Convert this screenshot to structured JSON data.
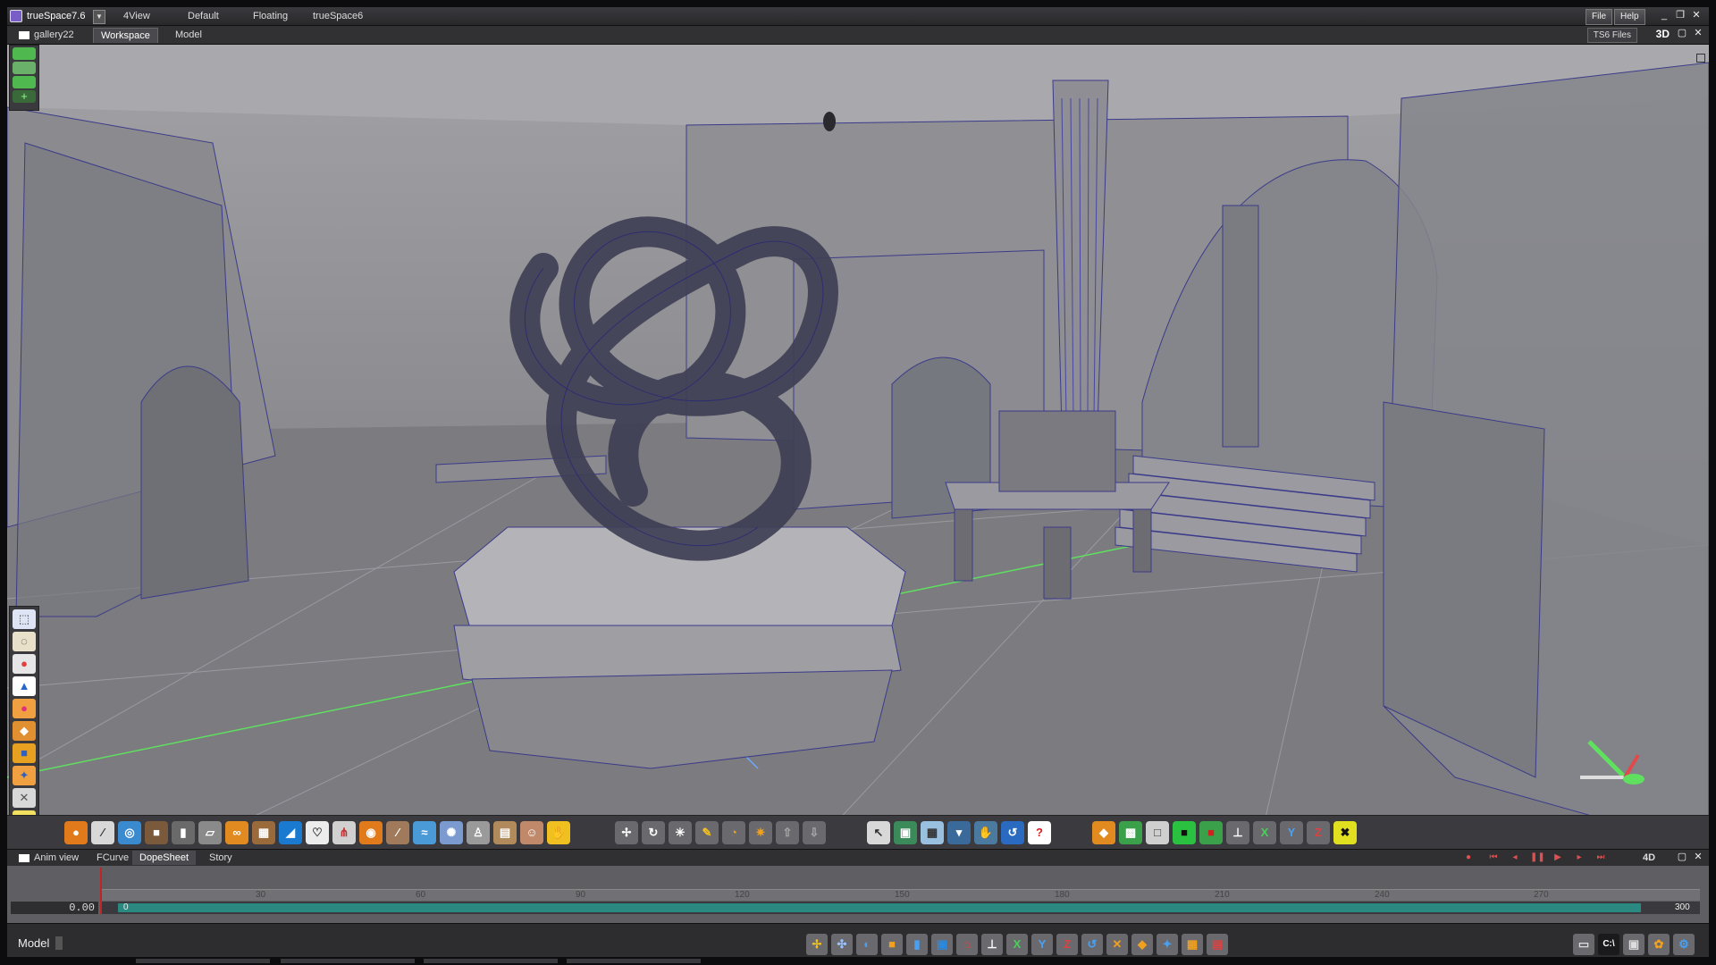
{
  "app": {
    "title": "trueSpace7.6",
    "layouts": [
      "4View",
      "Default",
      "Floating",
      "trueSpace6"
    ],
    "menu": {
      "file": "File",
      "help": "Help"
    },
    "window_controls": {
      "minimize": "_",
      "restore": "❐",
      "close": "✕"
    }
  },
  "tabs": {
    "scene": "gallery22",
    "workspace": "Workspace",
    "model": "Model",
    "files_button": "TS6 Files",
    "view_mode": "3D"
  },
  "viewport": {
    "colors": {
      "background_top": "#a2a2a6",
      "floor": "#7b7b80",
      "wireframe": "#3b3b8a",
      "axis_x": "#5fe05f",
      "axis_y": "#6aa8ff"
    }
  },
  "left_toolbar_icons": [
    "select-icon",
    "lasso-icon",
    "paint-icon",
    "cone-icon",
    "sphere-icon",
    "material-icon",
    "cube-icon",
    "light-icon",
    "wrench-icon",
    "pencil-icon",
    "gear-icon"
  ],
  "bottom_toolbar_icons": [
    "sphere-icon",
    "brush-icon",
    "torus-icon",
    "cube-icon",
    "cylinder-icon",
    "plane-icon",
    "knot-icon",
    "tree-icon",
    "stone-icon",
    "heart-icon",
    "fork-icon",
    "globe-icon",
    "wand-icon",
    "text-icon",
    "blob-icon",
    "figure-icon",
    "book-icon",
    "head-icon",
    "paint-icon",
    "move-icon",
    "rotate-icon",
    "scale-icon",
    "pin-icon",
    "orbit-icon",
    "star-icon",
    "up-arrow-icon",
    "down-arrow-icon",
    "pointer-icon",
    "box-icon",
    "grid-icon",
    "save-icon",
    "palm-icon",
    "wave-icon",
    "help-icon",
    "green-cube-icon",
    "frame-icon",
    "black-frame-icon",
    "red-frame-icon",
    "axes-icon"
  ],
  "axis_buttons": {
    "x": "X",
    "y": "Y",
    "z": "Z"
  },
  "anim": {
    "title": "Anim view",
    "tabs": [
      "FCurve",
      "DopeSheet",
      "Story"
    ],
    "active_tab": "DopeSheet",
    "mode": "4D",
    "time_value": "0.00",
    "start_frame": "0",
    "end_frame": "300",
    "ticks": [
      "30",
      "60",
      "90",
      "120",
      "150",
      "180",
      "210",
      "240",
      "270"
    ]
  },
  "status": {
    "mode_label": "Model"
  },
  "status_axes": {
    "x": "X",
    "y": "Y",
    "z": "Z"
  },
  "tray_label": "C:\\"
}
